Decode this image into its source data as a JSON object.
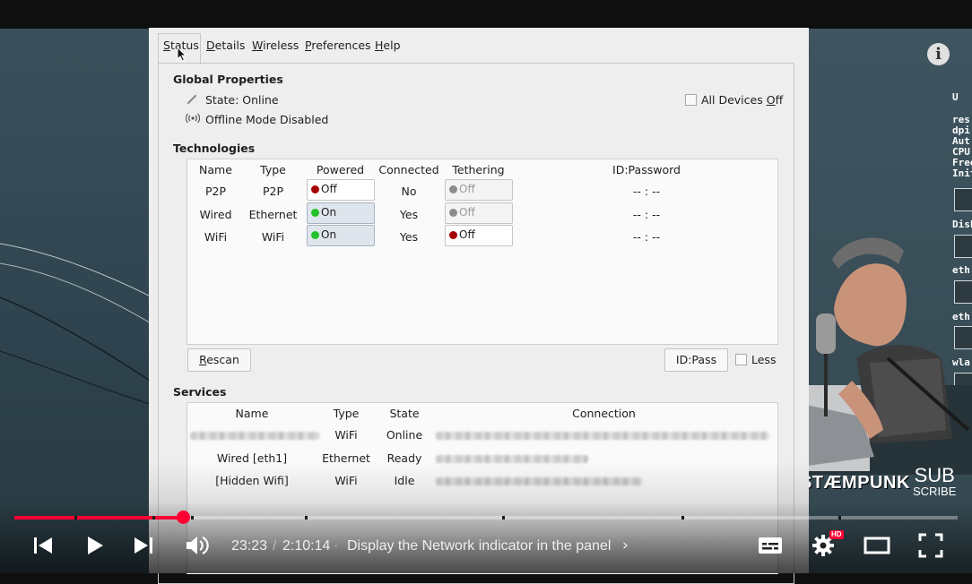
{
  "app": {
    "menu": [
      {
        "label": "Status",
        "mnemonic": "S",
        "rest": "tatus"
      },
      {
        "label": "Details",
        "mnemonic": "D",
        "rest": "etails"
      },
      {
        "label": "Wireless",
        "mnemonic": "W",
        "rest": "ireless"
      },
      {
        "label": "Preferences",
        "mnemonic": "P",
        "rest": "references"
      },
      {
        "label": "Help",
        "mnemonic": "H",
        "rest": "elp"
      }
    ],
    "global": {
      "title": "Global Properties",
      "state": "State: Online",
      "offline_mode": "Offline Mode Disabled",
      "all_devices_prefix": "All Devices ",
      "all_devices_mnemonic": "O",
      "all_devices_rest": "ff"
    },
    "technologies": {
      "title": "Technologies",
      "headers": [
        "Name",
        "Type",
        "Powered",
        "Connected",
        "Tethering",
        "ID:Password"
      ],
      "rows": [
        {
          "name": "P2P",
          "type": "P2P",
          "powered": "Off",
          "connected": "No",
          "tethering": "Off",
          "idpass": "-- : --"
        },
        {
          "name": "Wired",
          "type": "Ethernet",
          "powered": "On",
          "connected": "Yes",
          "tethering": "Off",
          "idpass": "-- : --"
        },
        {
          "name": "WiFi",
          "type": "WiFi",
          "powered": "On",
          "connected": "Yes",
          "tethering": "Off",
          "idpass": "-- : --"
        }
      ],
      "rescan_mnemonic": "R",
      "rescan_rest": "escan",
      "idpass_button": "ID:Pass",
      "less": "Less"
    },
    "services": {
      "title": "Services",
      "headers": [
        "Name",
        "Type",
        "State",
        "Connection"
      ],
      "rows": [
        {
          "name": "",
          "type": "WiFi",
          "state": "Online"
        },
        {
          "name": "Wired [eth1]",
          "type": "Ethernet",
          "state": "Ready"
        },
        {
          "name": "[Hidden Wifi]",
          "type": "WiFi",
          "state": "Idle"
        }
      ]
    }
  },
  "colors": {
    "status_green": "#22c32a",
    "status_red": "#a80000",
    "status_gray": "#8c8c8c",
    "progress_red": "#ff0033"
  },
  "overlay": {
    "channel_logo": "STÆMPUNK",
    "subscribe_top": "SUB",
    "subscribe_bottom": "SCRIBE",
    "info_icon": "info-icon"
  },
  "player": {
    "current_time": "23:23",
    "separator": "/",
    "duration": "2:10:14",
    "bullet": "·",
    "chapter": "Display the Network indicator in the panel",
    "chevron": "›",
    "hd_badge": "HD",
    "progress_fraction": 0.1789
  }
}
